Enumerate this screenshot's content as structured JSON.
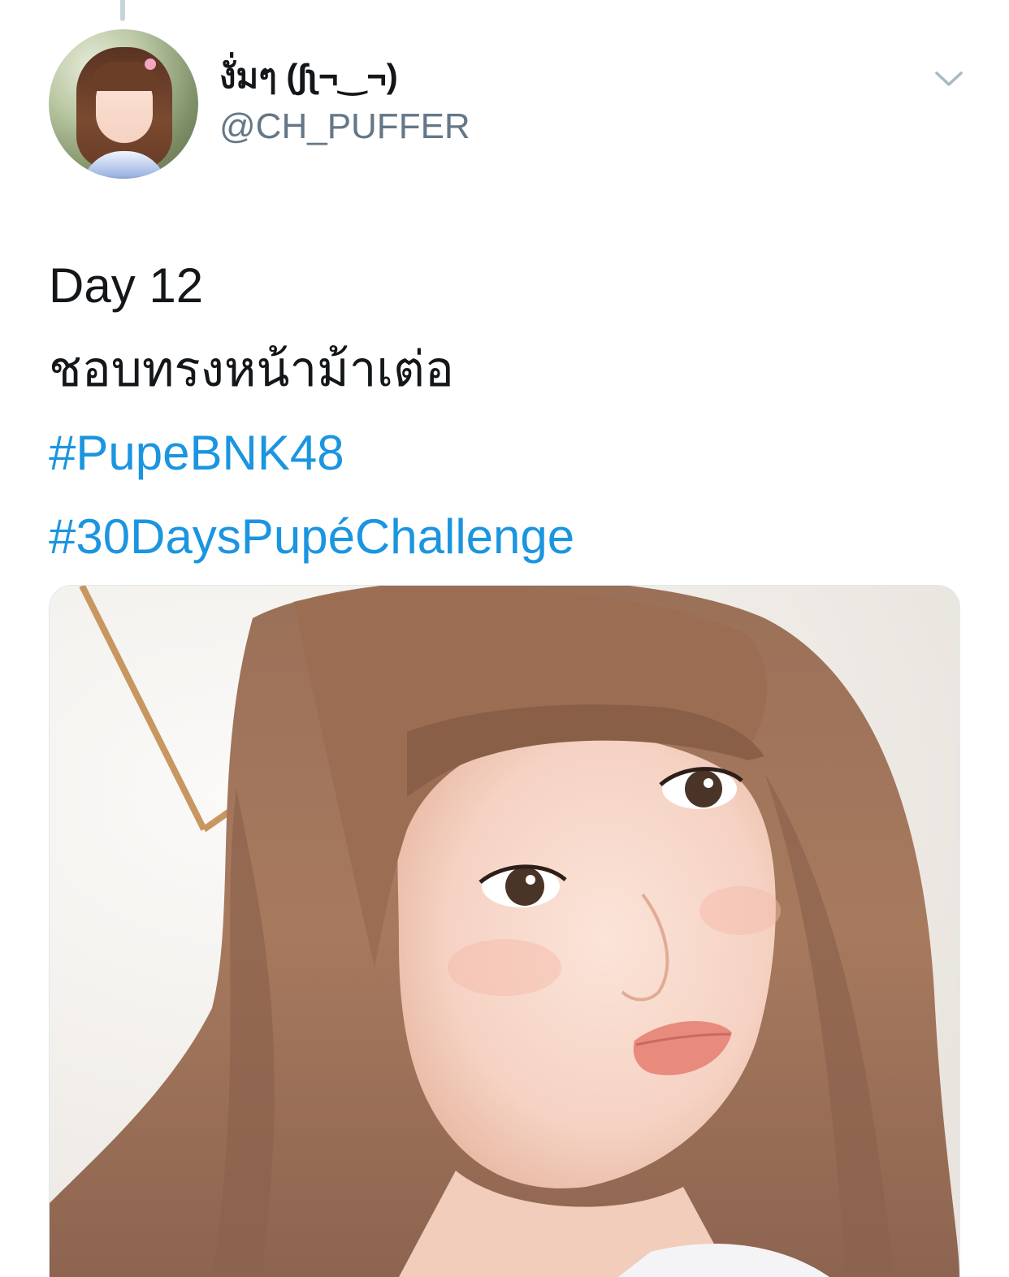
{
  "tweet": {
    "author": {
      "display_name": "งั่มๆ (∫ʅ¬‿¬)",
      "username": "@CH_PUFFER"
    },
    "text_lines": [
      {
        "text": "Day 12",
        "type": "text"
      },
      {
        "text": "ชอบทรงหน้าม้าเต่อ",
        "type": "text"
      },
      {
        "text": "#PupeBNK48",
        "type": "hashtag"
      },
      {
        "text": "#30DaysPupéChallenge",
        "type": "hashtag"
      }
    ],
    "menu_icon": "chevron-down-icon"
  },
  "colors": {
    "hashtag": "#1b95e0",
    "username": "#657786",
    "text": "#14171a"
  }
}
